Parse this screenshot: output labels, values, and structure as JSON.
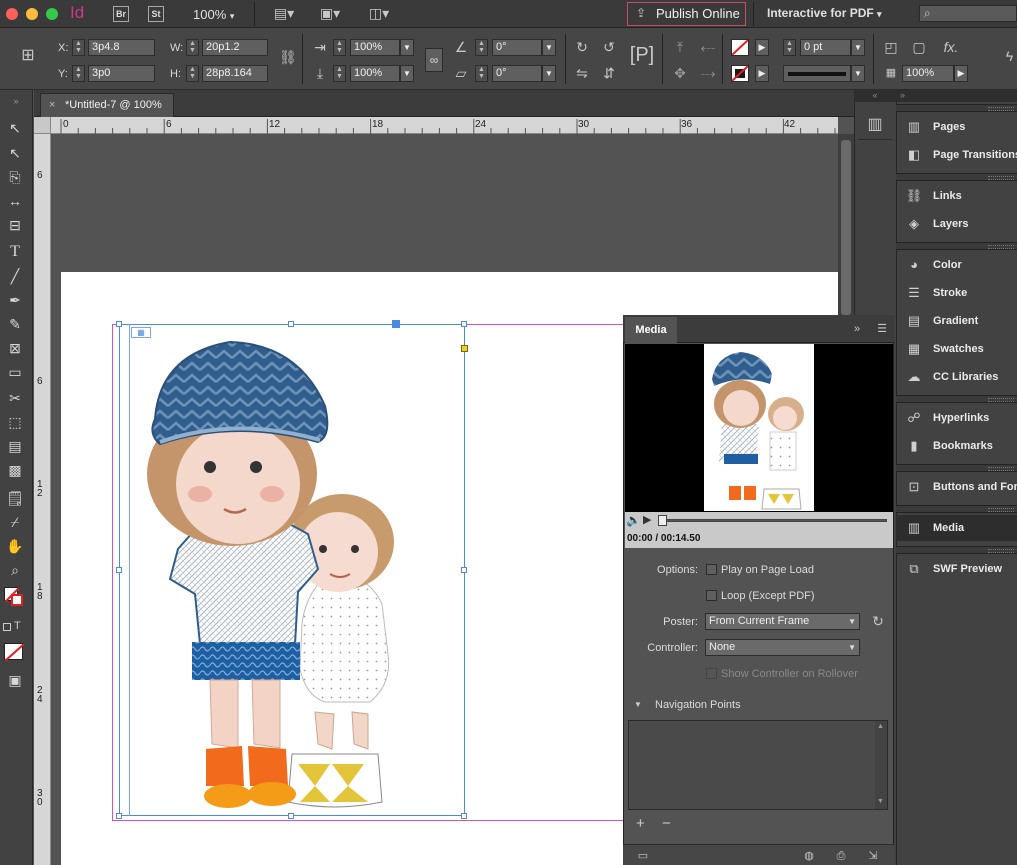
{
  "app": {
    "brand_id": "Id",
    "brand_br": "Br",
    "brand_st": "St",
    "zoom": "100%",
    "publish_label": "Publish Online",
    "workspace": "Interactive for PDF"
  },
  "control": {
    "x_label": "X:",
    "x_value": "3p4.8",
    "y_label": "Y:",
    "y_value": "3p0",
    "w_label": "W:",
    "w_value": "20p1.2",
    "h_label": "H:",
    "h_value": "28p8.164",
    "scale_x": "100%",
    "scale_y": "100%",
    "rotate": "0°",
    "shear": "0°",
    "stroke_weight": "0 pt",
    "opacity": "100%"
  },
  "document": {
    "tab_title": "*Untitled-7 @ 100%"
  },
  "ruler": {
    "h_ticks": [
      "0",
      "6",
      "12",
      "18",
      "24",
      "30",
      "36",
      "42"
    ],
    "v_ticks": [
      "6",
      "6",
      "1 2",
      "1 8",
      "2 4",
      "3 0"
    ]
  },
  "dock": {
    "items": [
      {
        "label": "Pages",
        "icon": "pages-icon"
      },
      {
        "label": "Page Transitions",
        "icon": "page-transitions-icon"
      },
      {
        "label": "Links",
        "icon": "links-icon"
      },
      {
        "label": "Layers",
        "icon": "layers-icon"
      },
      {
        "label": "Color",
        "icon": "color-icon"
      },
      {
        "label": "Stroke",
        "icon": "stroke-icon"
      },
      {
        "label": "Gradient",
        "icon": "gradient-icon"
      },
      {
        "label": "Swatches",
        "icon": "swatches-icon"
      },
      {
        "label": "CC Libraries",
        "icon": "cc-libraries-icon"
      },
      {
        "label": "Hyperlinks",
        "icon": "hyperlinks-icon"
      },
      {
        "label": "Bookmarks",
        "icon": "bookmarks-icon"
      },
      {
        "label": "Buttons and Forms",
        "icon": "buttons-forms-icon"
      },
      {
        "label": "Media",
        "icon": "media-icon"
      },
      {
        "label": "SWF Preview",
        "icon": "swf-preview-icon"
      }
    ]
  },
  "media": {
    "title": "Media",
    "timecode": "00:00 / 00:14.50",
    "options_label": "Options:",
    "play_on_load": "Play on Page Load",
    "loop": "Loop (Except PDF)",
    "poster_label": "Poster:",
    "poster_value": "From Current Frame",
    "controller_label": "Controller:",
    "controller_value": "None",
    "show_controller": "Show Controller on Rollover",
    "nav_points": "Navigation Points"
  }
}
